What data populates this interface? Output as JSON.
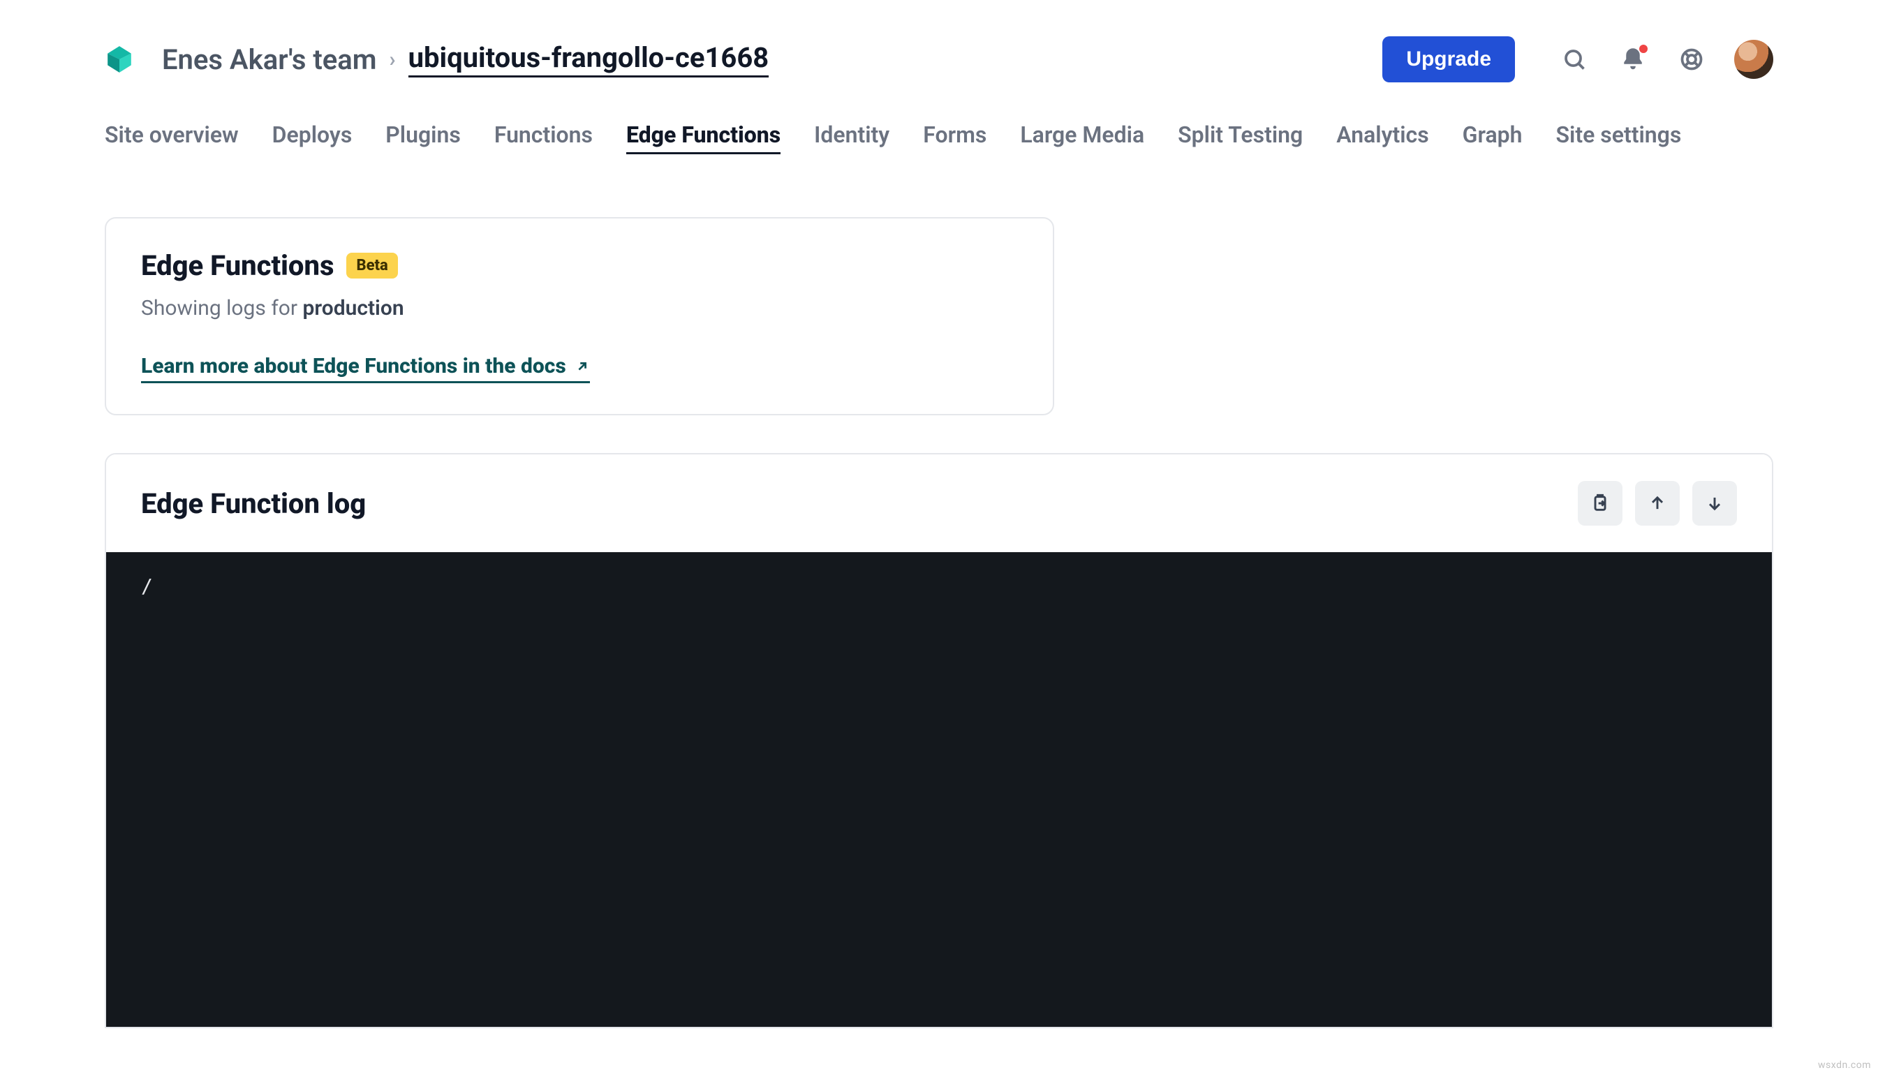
{
  "header": {
    "team_name": "Enes Akar's team",
    "site_name": "ubiquitous-frangollo-ce1668",
    "upgrade_label": "Upgrade"
  },
  "tabs": [
    {
      "label": "Site overview",
      "active": false
    },
    {
      "label": "Deploys",
      "active": false
    },
    {
      "label": "Plugins",
      "active": false
    },
    {
      "label": "Functions",
      "active": false
    },
    {
      "label": "Edge Functions",
      "active": true
    },
    {
      "label": "Identity",
      "active": false
    },
    {
      "label": "Forms",
      "active": false
    },
    {
      "label": "Large Media",
      "active": false
    },
    {
      "label": "Split Testing",
      "active": false
    },
    {
      "label": "Analytics",
      "active": false
    },
    {
      "label": "Graph",
      "active": false
    },
    {
      "label": "Site settings",
      "active": false
    }
  ],
  "card": {
    "title": "Edge Functions",
    "badge": "Beta",
    "sub_prefix": "Showing logs for ",
    "sub_bold": "production",
    "learn_more": "Learn more about Edge Functions in the docs"
  },
  "log": {
    "title": "Edge Function log",
    "content": "/"
  },
  "icons": {
    "search": "search-icon",
    "notifications": "bell-icon",
    "help": "lifebuoy-icon",
    "avatar": "user-avatar",
    "export": "clipboard-export-icon",
    "scroll_up": "arrow-up-icon",
    "scroll_down": "arrow-down-icon",
    "external": "external-link-icon"
  },
  "watermark": "wsxdn.com"
}
